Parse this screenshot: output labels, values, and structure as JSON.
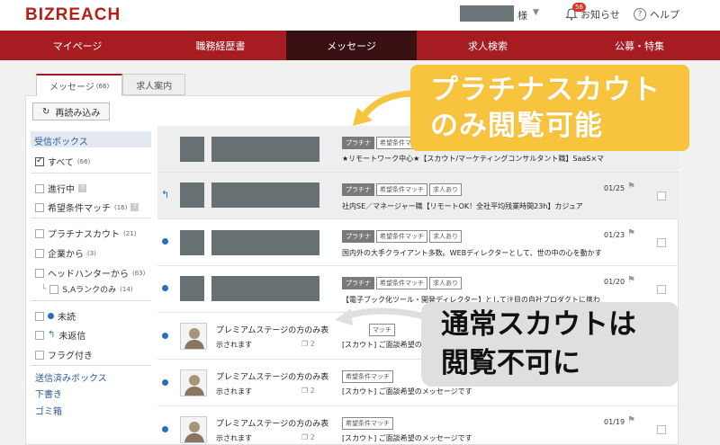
{
  "header": {
    "logo": "BIZREACH",
    "user_suffix": "様",
    "notifications_label": "お知らせ",
    "notifications_count": "56",
    "help_label": "ヘルプ"
  },
  "nav": {
    "items": [
      "マイページ",
      "職務経歴書",
      "メッセージ",
      "求人検索",
      "公募・特集"
    ]
  },
  "tabs": {
    "messages_label": "メッセージ",
    "messages_count": "(66)",
    "jobs_label": "求人案内"
  },
  "toolbar": {
    "reload_label": "再読み込み"
  },
  "sidebar": {
    "inbox_label": "受信ボックス",
    "all_label": "すべて",
    "all_count": "(66)",
    "in_progress_label": "進行中",
    "match_label": "希望条件マッチ",
    "match_count": "(16)",
    "q_mark": "?",
    "platinum_label": "プラチナスカウト",
    "platinum_count": "(21)",
    "company_label": "企業から",
    "company_count": "(3)",
    "headhunter_label": "ヘッドハンターから",
    "headhunter_count": "(63)",
    "s_rank_label": "S,Aランクのみ",
    "s_rank_count": "(14)",
    "unread_label": "未読",
    "unreplied_label": "未返信",
    "flagged_label": "フラグ付き",
    "sent_label": "送信済みボックス",
    "drafts_label": "下書き",
    "trash_label": "ゴミ箱"
  },
  "messages": {
    "row1": {
      "tags": [
        "プラチナ",
        "希望条件マッチ"
      ],
      "subject": "★リモートワーク中心★【スカウト/マーケティングコンサルタント職】SaaS×マ"
    },
    "row2": {
      "tags": [
        "プラチナ",
        "希望条件マッチ",
        "求人あり"
      ],
      "date": "01/25",
      "subject": "社内SE／マネージャー職【リモートOK！全社平均残業時間23h】カジュア"
    },
    "row3": {
      "tags": [
        "プラチナ",
        "希望条件マッチ",
        "求人あり"
      ],
      "date": "01/23",
      "subject": "国内外の大手クライアント多数。WEBディレクターとして、世の中の心を動かす"
    },
    "row4": {
      "tags": [
        "プラチナ",
        "希望条件マッチ",
        "求人あり"
      ],
      "date": "01/20",
      "subject": "【電子ブック化ツール・開発ディレクター】として注目の自社プロダクトに携わ"
    },
    "row5": {
      "sender": "プレミアムステージの方のみ表",
      "sender_sub": "示されます",
      "attach": "2",
      "tags": [
        "マッチ"
      ],
      "subject": "[スカウト] ご面談希望のメッセージです"
    },
    "row6": {
      "sender": "プレミアムステージの方のみ表",
      "sender_sub": "示されます",
      "attach": "2",
      "tags": [
        "希望条件マッチ"
      ],
      "subject": "[スカウト] ご面談希望のメッセージです"
    },
    "row7": {
      "sender": "プレミアムステージの方のみ表",
      "sender_sub": "示されます",
      "attach": "2",
      "tags": [
        "希望条件マッチ"
      ],
      "date": "01/19",
      "subject": "[スカウト] ご面談希望のメッセージです"
    }
  },
  "callouts": {
    "platinum_line1": "プラチナスカウト",
    "platinum_line2": "のみ閲覧可能",
    "normal_line1": "通常スカウトは",
    "normal_line2": "閲覧不可に"
  },
  "colors": {
    "brand_red": "#a61c21",
    "nav_active": "#3a1112",
    "callout_orange": "#f8c43e",
    "link_blue": "#2a5a9a"
  }
}
